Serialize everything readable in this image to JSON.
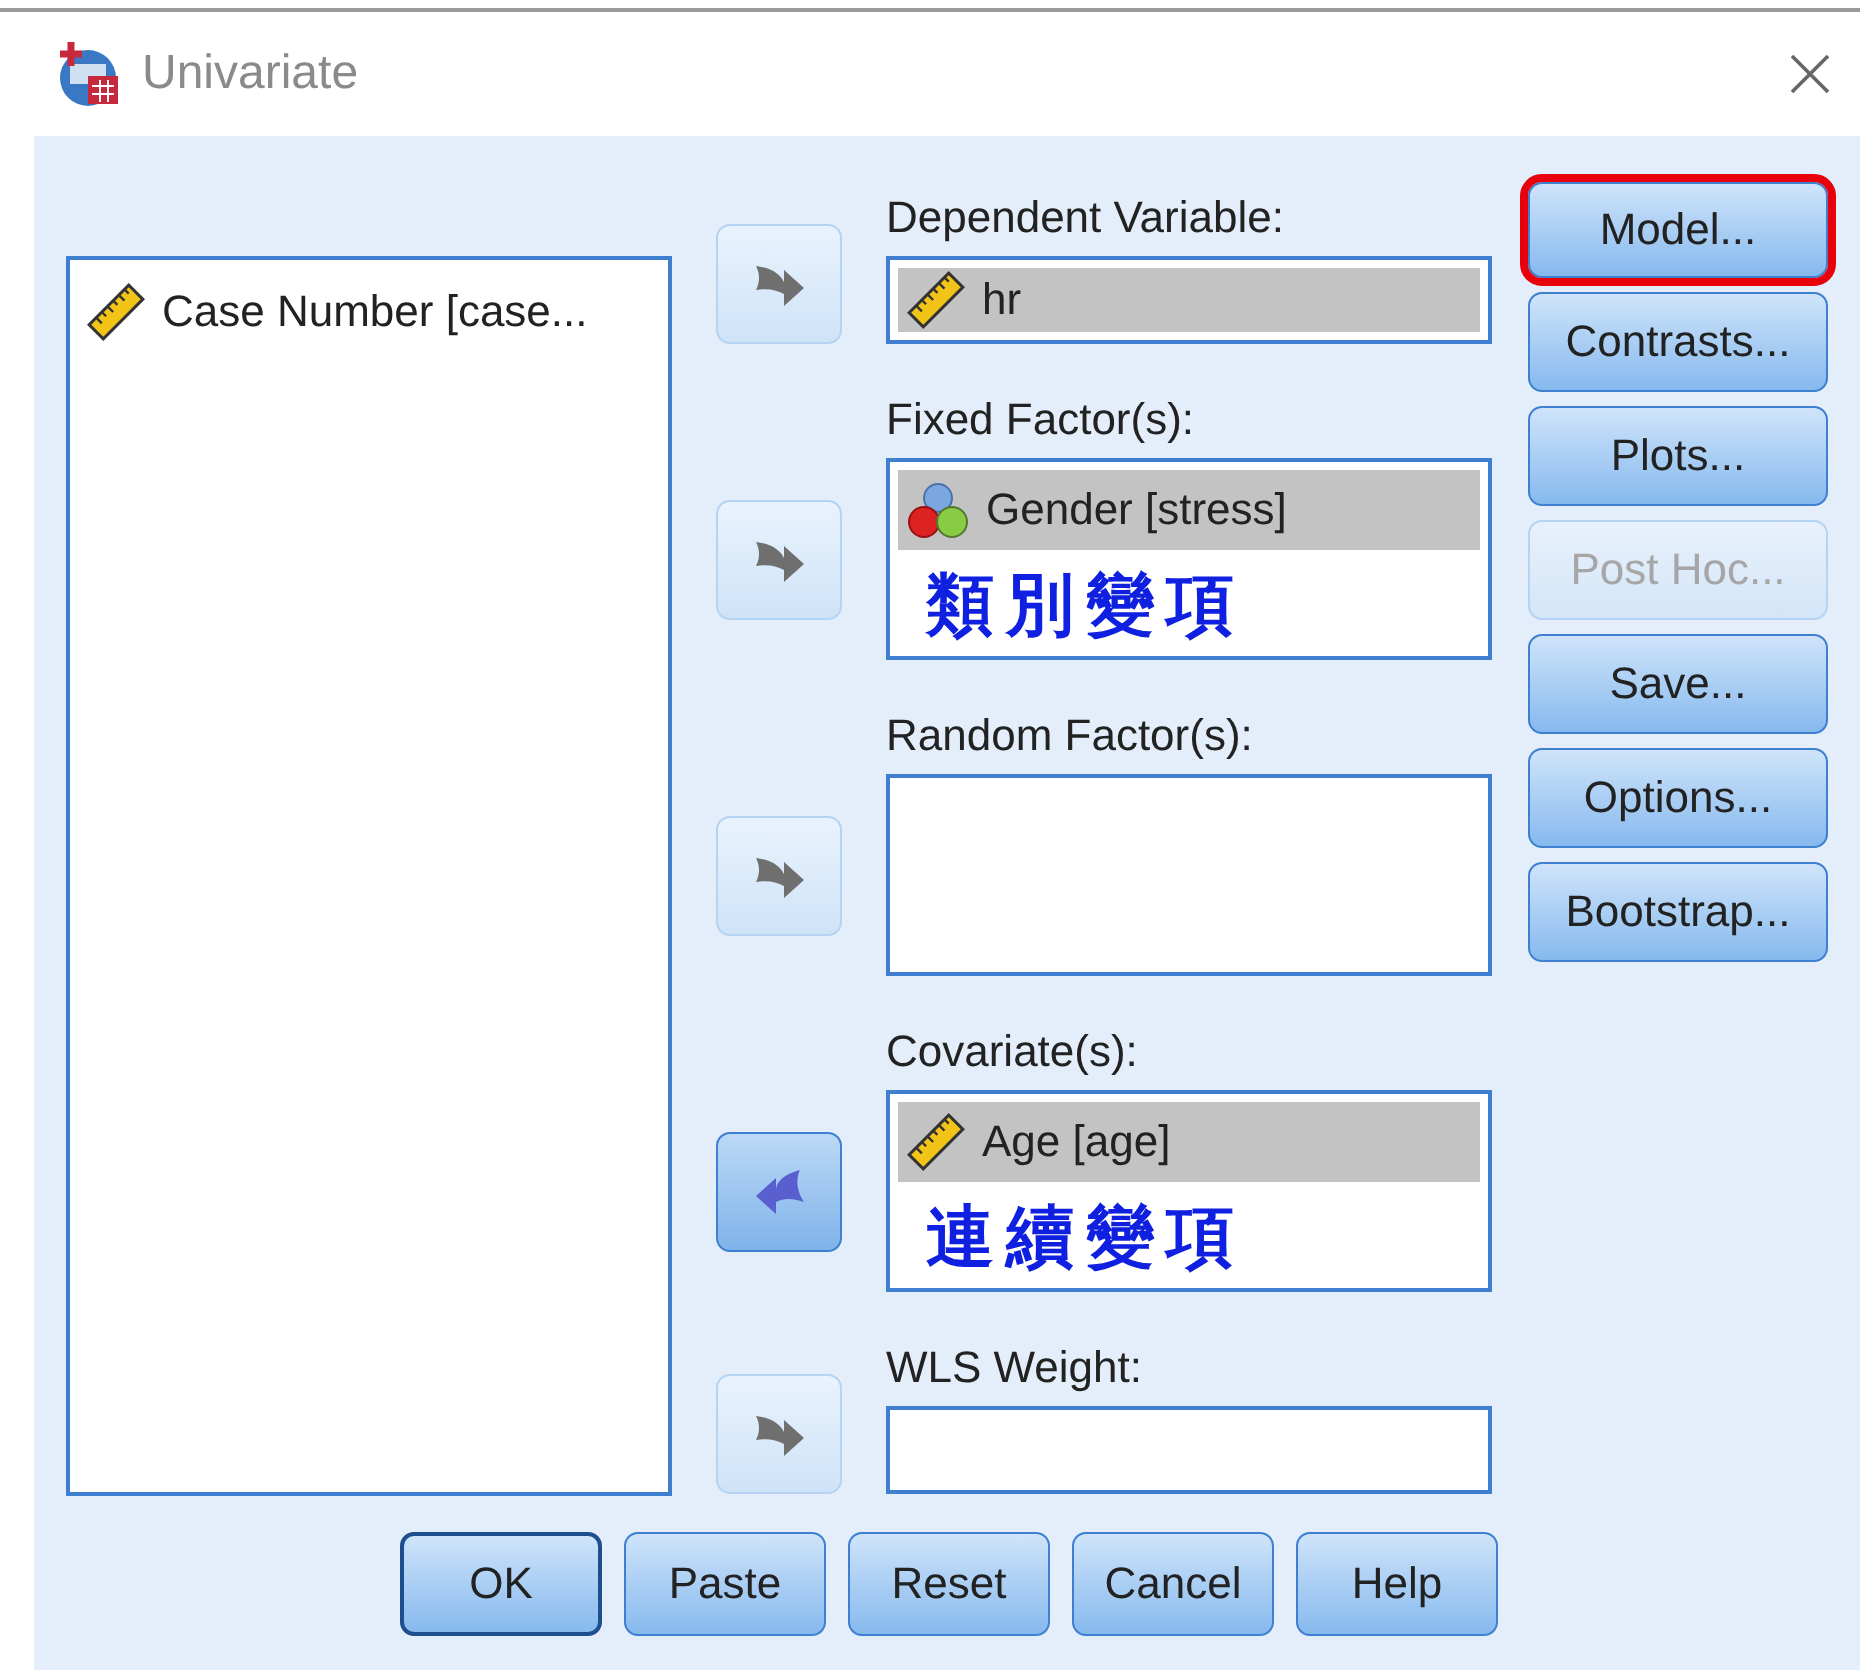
{
  "window": {
    "title": "Univariate"
  },
  "source_list": {
    "items": [
      {
        "label": "Case Number [case...",
        "kind": "scale",
        "selected": false
      }
    ]
  },
  "target_fields": [
    {
      "label": "Dependent Variable:",
      "arrow": {
        "kind": "right",
        "active": false
      },
      "kind": "single",
      "items": [
        {
          "label": "hr",
          "kind": "scale",
          "selected": true
        }
      ]
    },
    {
      "label": "Fixed Factor(s):",
      "arrow": {
        "kind": "right",
        "active": false
      },
      "kind": "list",
      "items": [
        {
          "label": "Gender [stress]",
          "kind": "nominal",
          "selected": true
        }
      ],
      "annotation": "類別變項"
    },
    {
      "label": "Random Factor(s):",
      "arrow": {
        "kind": "right",
        "active": false
      },
      "kind": "list"
    },
    {
      "label": "Covariate(s):",
      "arrow": {
        "kind": "left",
        "active": true
      },
      "kind": "list",
      "items": [
        {
          "label": "Age [age]",
          "kind": "scale",
          "selected": true
        }
      ],
      "annotation": "連續變項"
    },
    {
      "label": "WLS Weight:",
      "arrow": {
        "kind": "right",
        "active": false
      },
      "kind": "single"
    }
  ],
  "side_buttons": [
    {
      "label": "Model...",
      "disabled": false,
      "highlighted": true
    },
    {
      "label": "Contrasts...",
      "disabled": false,
      "highlighted": false
    },
    {
      "label": "Plots...",
      "disabled": false,
      "highlighted": false
    },
    {
      "label": "Post Hoc...",
      "disabled": true,
      "highlighted": false
    },
    {
      "label": "Save...",
      "disabled": false,
      "highlighted": false
    },
    {
      "label": "Options...",
      "disabled": false,
      "highlighted": false
    },
    {
      "label": "Bootstrap...",
      "disabled": false,
      "highlighted": false
    }
  ],
  "bottom_buttons": [
    {
      "label": "OK",
      "default": true
    },
    {
      "label": "Paste",
      "default": false
    },
    {
      "label": "Reset",
      "default": false
    },
    {
      "label": "Cancel",
      "default": false
    },
    {
      "label": "Help",
      "default": false
    }
  ]
}
